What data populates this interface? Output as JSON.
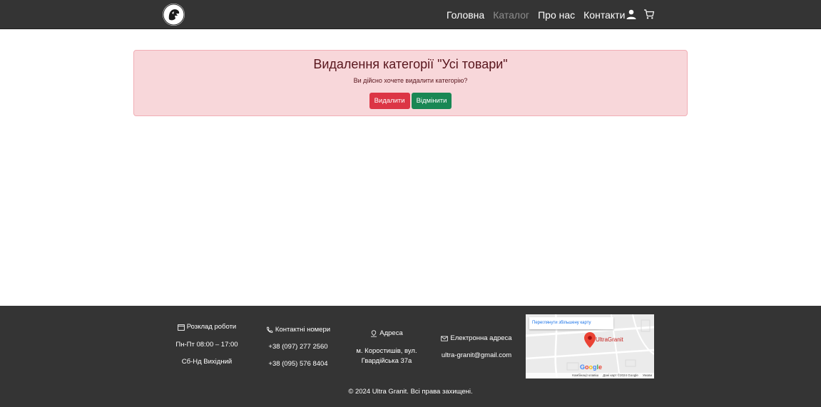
{
  "nav": {
    "links": [
      "Головна",
      "Каталог",
      "Про нас",
      "Контакти"
    ],
    "active_index": 1,
    "icons": [
      "logo-icon",
      "user-icon",
      "cart-icon"
    ]
  },
  "alert": {
    "title": "Видалення категорії \"Усі товари\"",
    "text": "Ви дійсно хочете видалити категорію?",
    "delete_label": "Видалити",
    "cancel_label": "Відмінити"
  },
  "footer": {
    "schedule": {
      "heading": "Розклад роботи",
      "lines": [
        "Пн-Пт 08:00 – 17:00",
        "Сб-Нд Вихідний"
      ]
    },
    "phones": {
      "heading": "Контактні номери",
      "lines": [
        "+38 (097) 277 2560",
        "+38 (095) 576 8404"
      ]
    },
    "address": {
      "heading": "Адреса",
      "lines": [
        "м. Коростишів, вул.",
        "Гвардійська 37а"
      ]
    },
    "email": {
      "heading": "Eлектронна адреса",
      "lines": [
        "ultra-granit@gmail.com"
      ]
    },
    "map": {
      "link": "Переглянути збільшену карту",
      "label": "UltraGranit",
      "google": "Google",
      "footer": [
        "Комбінації клавіш",
        "Дані карт ©2024 Google",
        "Умови"
      ]
    },
    "copyright": "© 2024 Ultra Granit. Всі права захищені."
  },
  "colors": {
    "navbar": "#343434",
    "alert_bg": "#f8d7da",
    "danger": "#dc3545",
    "success": "#198754"
  }
}
